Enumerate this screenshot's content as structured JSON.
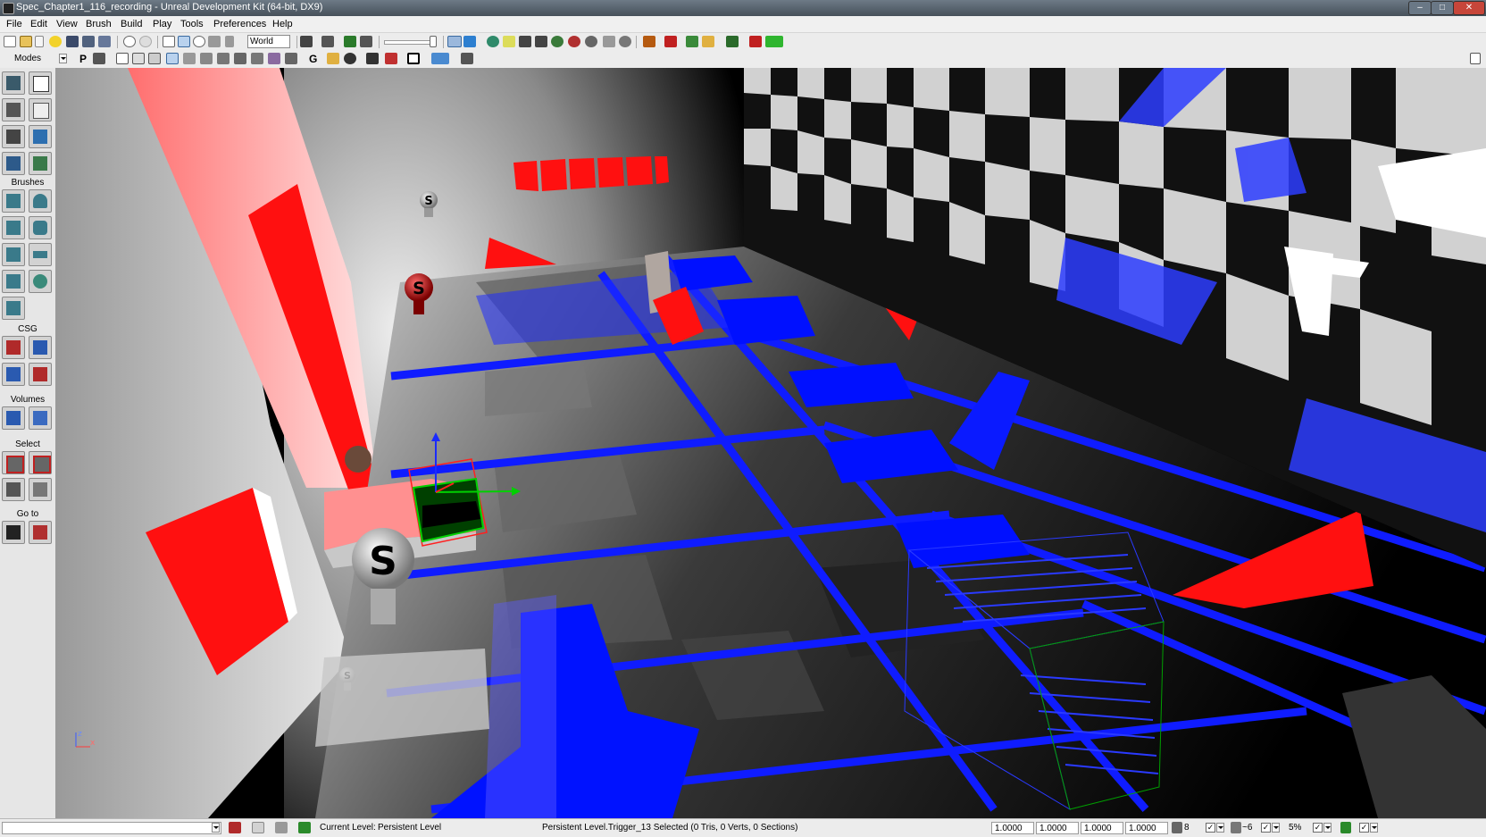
{
  "window": {
    "title": "Spec_Chapter1_116_recording - Unreal Development Kit (64-bit, DX9)"
  },
  "menu": [
    "File",
    "Edit",
    "View",
    "Brush",
    "Build",
    "Play",
    "Tools",
    "Preferences",
    "Help"
  ],
  "toolbar": {
    "coord_system": "World",
    "toolbar2_letter_p": "P",
    "toolbar2_letter_g": "G"
  },
  "modes_panel": {
    "title": "Modes",
    "sections": {
      "brushes": "Brushes",
      "csg": "CSG",
      "volumes": "Volumes",
      "select": "Select",
      "goto": "Go to"
    }
  },
  "viewport": {
    "sprite_letter": "S",
    "axis_z": "z",
    "axis_x": "x"
  },
  "status": {
    "current_level_label": "Current Level:",
    "current_level_value": "Persistent Level",
    "selection": "Persistent Level.Trigger_13 Selected (0 Tris, 0 Verts, 0 Sections)",
    "drag_values": [
      "1.0000",
      "1.0000",
      "1.0000",
      "1.0000"
    ],
    "grid_size": "8",
    "rotation_snap": "~6",
    "scale_snap": "5%"
  },
  "colors": {
    "accent_red": "#ff0000",
    "accent_blue": "#0010ff",
    "play_green": "#2fb52f"
  }
}
